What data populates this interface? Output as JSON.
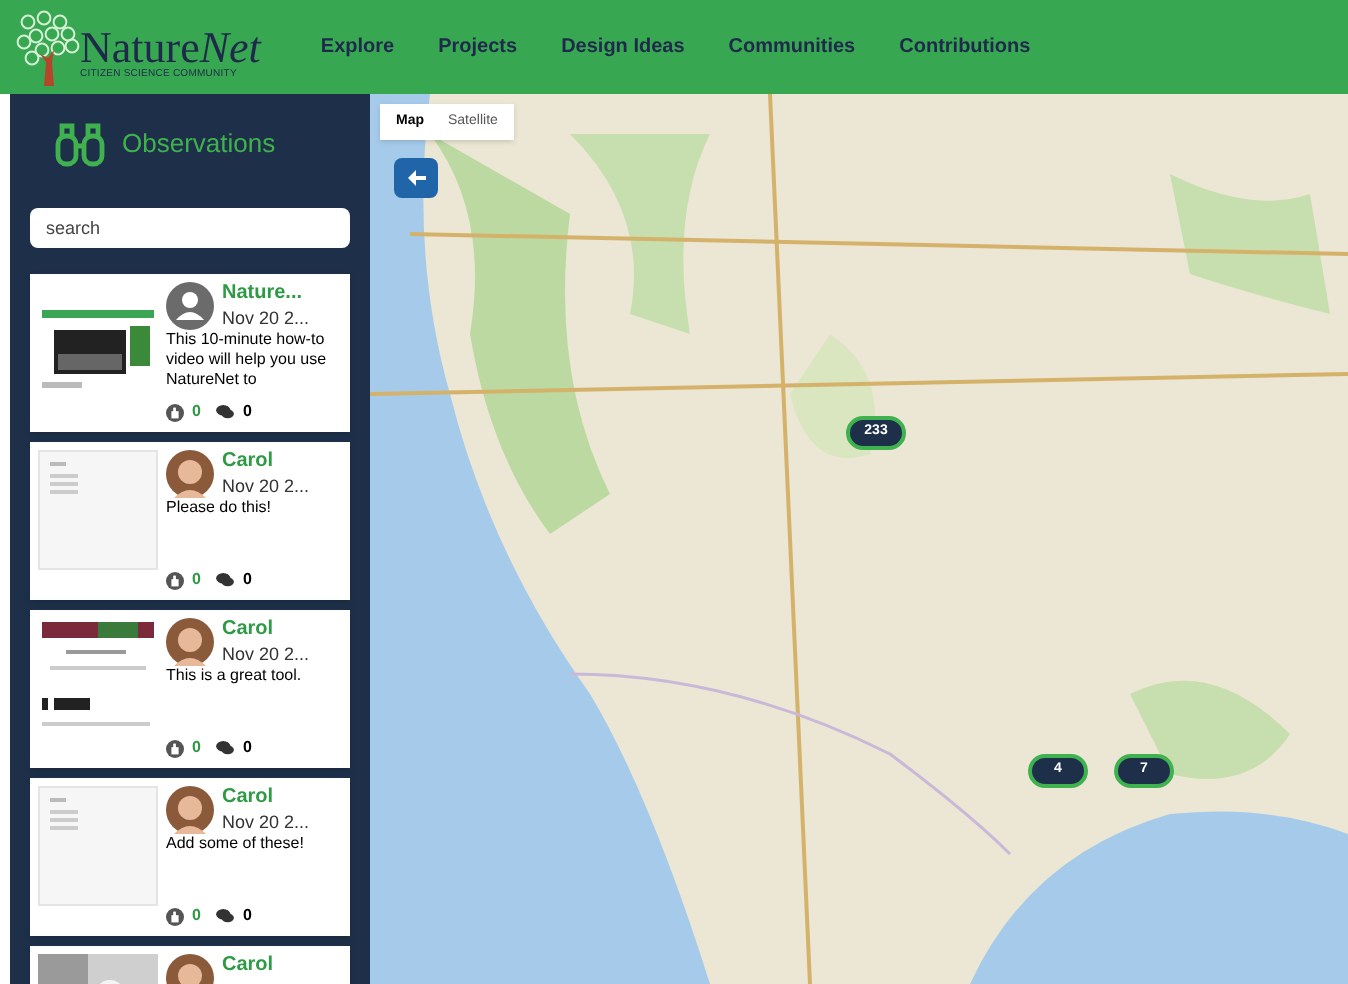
{
  "header": {
    "logo": "Nature",
    "logo_accent": "Net",
    "tagline": "CITIZEN SCIENCE COMMUNITY",
    "nav": [
      "Explore",
      "Projects",
      "Design Ideas",
      "Communities",
      "Contributions"
    ]
  },
  "sidebar": {
    "title": "Observations",
    "search": {
      "placeholder": "search"
    },
    "observations": [
      {
        "thumbnail": {
          "kind": "screenshot"
        },
        "avatar": {
          "kind": "default"
        },
        "name": "Nature...",
        "date": "Nov 20 2...",
        "text": "This 10-minute how-to video will help you use NatureNet to",
        "likes": "0",
        "comments": "0"
      },
      {
        "thumbnail": {
          "kind": "document"
        },
        "name": "Carol",
        "date": "Nov 20 2...",
        "text": "Please do this!",
        "likes": "0",
        "comments": "0"
      },
      {
        "thumbnail": {
          "kind": "webpage"
        },
        "name": "Carol",
        "date": "Nov 20 2...",
        "text": "This is a great tool.",
        "likes": "0",
        "comments": "0"
      },
      {
        "thumbnail": {
          "kind": "document"
        },
        "name": "Carol",
        "date": "Nov 20 2...",
        "text": "Add some of these!",
        "likes": "0",
        "comments": "0"
      },
      {
        "name": "Carol"
      }
    ]
  },
  "map": {
    "map_types": [
      {
        "label": "Map",
        "selected": true
      },
      {
        "label": "Satellite",
        "selected": false
      }
    ],
    "markers": [
      {
        "label": "233"
      },
      {
        "label": "4"
      },
      {
        "label": "7"
      }
    ]
  }
}
